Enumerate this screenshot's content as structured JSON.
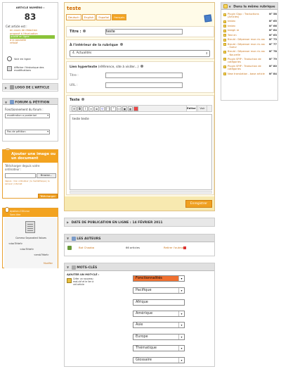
{
  "article_box": {
    "title": "ARTICLE NUMÉRO :",
    "number": "83",
    "status_label": "Cet article est :",
    "statuses": [
      "en cours de rédaction",
      "proposé à l'évaluation",
      "publié en ligne",
      "à la poubelle",
      "refusé"
    ],
    "view_online": "Voir en ligne",
    "history": "Afficher l'historique des modifications"
  },
  "logo_panel": {
    "title": "LOGO DE L'ARTICLE"
  },
  "forum_panel": {
    "title": "FORUM & PÉTITION",
    "forum_label": "Fonctionnement du forum :",
    "forum_value": "modération a posteriori",
    "petition_value": "Pas de pétition"
  },
  "upload_panel": {
    "title": "Ajouter une image ou un document",
    "sub": "Télécharger depuis votre ordinateur :",
    "browse": "Browse...",
    "links": "depuis : mon ordinateur | le mediathèque | le serveur | internet",
    "submit": "Télécharger"
  },
  "doc_panel": {
    "filename": "epsilon-CSV.csv",
    "no_title": "Sans titre",
    "doc_caption": "Comma Separated Values",
    "tag_line": "<doc7Ifdef>",
    "tag2": "<doc7Ifdef>",
    "tag3": "<emb7Ifdef>",
    "modify": "Modifier"
  },
  "editor": {
    "title": "teste",
    "lang_tabs": [
      "Deutsch",
      "English",
      "Español",
      "français"
    ],
    "titre_label": "Titre :",
    "titre_value": "teste",
    "rubrique_label": "À l'intérieur de la rubrique",
    "rubrique_value": "4. Actualités",
    "lien_label": "Lien hypertexte",
    "lien_hint": "(référence, site à visiter...)",
    "lien_titre": "Titre :",
    "lien_url": "URL :",
    "texte_label": "Texte",
    "editer": "Éditer",
    "voir": "Voir",
    "texte_value": "teste teste",
    "save": "Enregistrer"
  },
  "date_panel": {
    "title": "DATE DE PUBLICATION EN LIGNE :",
    "date": "14 FÉVRIER 2011"
  },
  "authors_panel": {
    "title": "LES AUTEURS",
    "name": "Bot Chaaba",
    "articles": "66 articles",
    "remove": "Retirer l'auteur"
  },
  "keywords_panel": {
    "title": "MOTS-CLÉS",
    "add_label": "AJOUTER UN MOT-CLÉ :",
    "create_text": "Créer un nouveau mot-clé et le lier à cet article",
    "groups": [
      "Fonctionnalités",
      "Pacifique",
      "Afrique",
      "Amérique",
      "Asie",
      "Europe",
      "Thématique",
      "Glossaire"
    ]
  },
  "rubrique_panel": {
    "title": "Dans la même rubrique",
    "items": [
      {
        "t": "Plugin Gipp : Traductions (Articles)",
        "n": "N° 58"
      },
      {
        "t": "testex",
        "n": "N° 65"
      },
      {
        "t": "testex",
        "n": "N° 66"
      },
      {
        "t": "testgh re",
        "n": "N° 64"
      },
      {
        "t": "Test en",
        "n": "N° 63"
      },
      {
        "t": "Bizuld : Dépenser mon ric-rac",
        "n": "N° 73"
      },
      {
        "t": "Bizuld : Dépenser mon ric-rac - Sueur",
        "n": "N° 77"
      },
      {
        "t": "Bizuld : Dépenser mon ric-rac - Nouvelle",
        "n": "N° 78"
      },
      {
        "t": "Plugin SPIP : Traduction de catégories",
        "n": "N° 79"
      },
      {
        "t": "Plugin SPIP : Traduction de catégories",
        "n": "N° 80"
      },
      {
        "t": "New translation - base article",
        "n": "N° 84"
      }
    ]
  }
}
